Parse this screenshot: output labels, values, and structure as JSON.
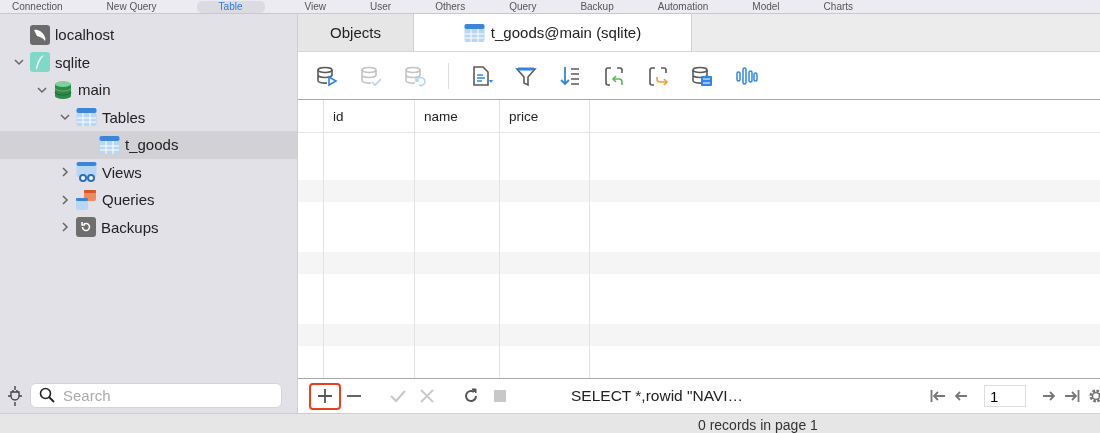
{
  "top_toolbar": {
    "items": [
      {
        "label": "Connection",
        "selected": false
      },
      {
        "label": "New Query",
        "selected": false
      },
      {
        "label": "Table",
        "selected": true
      },
      {
        "label": "View",
        "selected": false
      },
      {
        "label": "User",
        "selected": false
      },
      {
        "label": "Others",
        "selected": false
      },
      {
        "label": "Query",
        "selected": false
      },
      {
        "label": "Backup",
        "selected": false
      },
      {
        "label": "Automation",
        "selected": false
      },
      {
        "label": "Model",
        "selected": false
      },
      {
        "label": "Charts",
        "selected": false
      }
    ]
  },
  "sidebar": {
    "tree": [
      {
        "label": "localhost",
        "kind": "server",
        "selected": false
      },
      {
        "label": "sqlite",
        "kind": "sqlite",
        "expanded": true,
        "selected": false,
        "children": [
          {
            "label": "main",
            "kind": "database",
            "expanded": true,
            "selected": false,
            "children": [
              {
                "label": "Tables",
                "kind": "tables",
                "expanded": true,
                "selected": false,
                "children": [
                  {
                    "label": "t_goods",
                    "kind": "table",
                    "selected": true
                  }
                ]
              },
              {
                "label": "Views",
                "kind": "views",
                "expanded": false,
                "selected": false
              },
              {
                "label": "Queries",
                "kind": "queries",
                "expanded": false,
                "selected": false
              },
              {
                "label": "Backups",
                "kind": "backups",
                "expanded": false,
                "selected": false
              }
            ]
          }
        ]
      }
    ],
    "search": {
      "placeholder": "Search"
    }
  },
  "tabs": [
    {
      "label": "Objects",
      "selected": false
    },
    {
      "label": "t_goods@main (sqlite)",
      "selected": true
    }
  ],
  "toolbar": [
    {
      "kind": "run",
      "disabled": false
    },
    {
      "kind": "apply",
      "disabled": true
    },
    {
      "kind": "revert",
      "disabled": true
    },
    {
      "kind": "separator"
    },
    {
      "kind": "text",
      "disabled": false
    },
    {
      "kind": "filter",
      "disabled": false
    },
    {
      "kind": "sort",
      "disabled": false
    },
    {
      "kind": "import",
      "disabled": false
    },
    {
      "kind": "export",
      "disabled": false
    },
    {
      "kind": "generate",
      "disabled": false
    },
    {
      "kind": "chart",
      "disabled": false
    }
  ],
  "table": {
    "columns": [
      "id",
      "name",
      "price"
    ]
  },
  "bottom_bar": {
    "actions": [
      {
        "kind": "add",
        "disabled": false,
        "highlighted": true
      },
      {
        "kind": "remove",
        "disabled": false,
        "highlighted": false
      },
      {
        "kind": "commit",
        "disabled": true,
        "highlighted": false
      },
      {
        "kind": "discard",
        "disabled": true,
        "highlighted": false
      },
      {
        "kind": "refresh",
        "disabled": false,
        "highlighted": false
      },
      {
        "kind": "stop",
        "disabled": true,
        "highlighted": false
      }
    ],
    "sql": "SELECT *,rowid \"NAVI…",
    "page_field": "1"
  },
  "status_bar": "0 records in page 1"
}
